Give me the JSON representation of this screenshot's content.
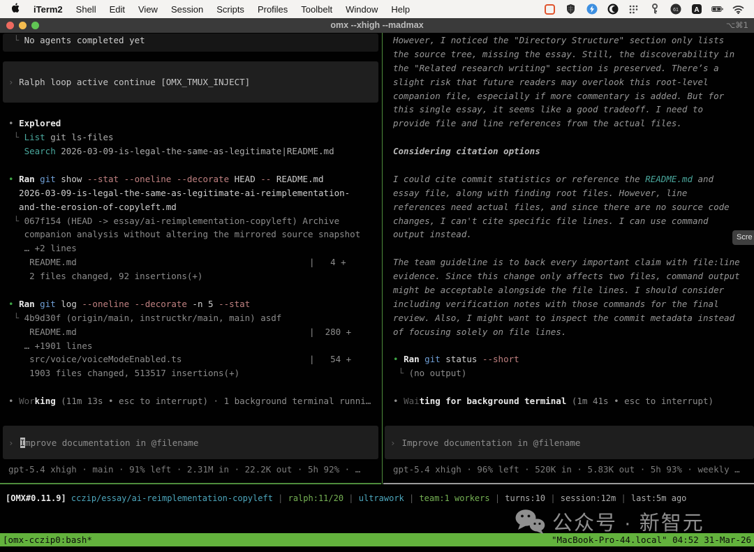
{
  "menubar": {
    "items": [
      "iTerm2",
      "Shell",
      "Edit",
      "View",
      "Session",
      "Scripts",
      "Profiles",
      "Toolbelt",
      "Window",
      "Help"
    ],
    "status_icons": [
      "recording-icon",
      "shield-icon",
      "lightning-circle-icon",
      "crescent-circle-icon",
      "dots-grid-icon",
      "key-icon",
      "timer-61-icon",
      "letter-a-icon",
      "battery-icon",
      "wifi-icon"
    ]
  },
  "titlebar": {
    "title": "omx --xhigh --madmax",
    "shortcut": "⌥⌘1"
  },
  "left_pane": {
    "rows": [
      {
        "s": [
          [
            "dim",
            " └ "
          ],
          [
            "w",
            "No agents completed yet"
          ]
        ]
      },
      {
        "s": []
      },
      {
        "s": []
      },
      {
        "s": [
          [
            "dim",
            "› "
          ],
          [
            "w2",
            "Ralph loop active continue [OMX_TMUX_INJECT]"
          ]
        ]
      },
      {
        "s": []
      },
      {
        "s": []
      },
      {
        "s": [
          [
            "g",
            "• "
          ],
          [
            "bw",
            "Explored"
          ]
        ]
      },
      {
        "s": [
          [
            "dim",
            " └ "
          ],
          [
            "teal",
            "List"
          ],
          [
            "g2",
            " git ls-files"
          ]
        ]
      },
      {
        "s": [
          [
            "g",
            "   "
          ],
          [
            "teal",
            "Search"
          ],
          [
            "g2",
            " 2026-03-09-is-legal-the-same-as-legitimate|README.md"
          ]
        ]
      },
      {
        "s": []
      },
      {
        "s": [
          [
            "green",
            "• "
          ],
          [
            "bw",
            "Ran"
          ],
          [
            "blue",
            " git"
          ],
          [
            "w",
            " show"
          ],
          [
            "rose",
            " --stat --oneline --decorate"
          ],
          [
            "w",
            " HEAD"
          ],
          [
            "rose",
            " --"
          ],
          [
            "w",
            " README.md"
          ]
        ]
      },
      {
        "s": [
          [
            "w",
            "  2026-03-09-is-legal-the-same-as-legitimate-ai-reimplementation-"
          ]
        ]
      },
      {
        "s": [
          [
            "w",
            "  and-the-erosion-of-copyleft.md"
          ]
        ]
      },
      {
        "s": [
          [
            "dim",
            " └ "
          ],
          [
            "g",
            "067f154 (HEAD -> essay/ai-reimplementation-copyleft) Archive"
          ]
        ]
      },
      {
        "s": [
          [
            "g",
            "   companion analysis without altering the mirrored source snapshot"
          ]
        ]
      },
      {
        "s": [
          [
            "g",
            "   … +2 lines"
          ]
        ]
      },
      {
        "s": [
          [
            "g",
            "    README.md"
          ]
        ],
        "r": [
          [
            "g",
            "|   4 +"
          ]
        ]
      },
      {
        "s": [
          [
            "g",
            "    2 files changed, 92 insertions(+)"
          ]
        ]
      },
      {
        "s": []
      },
      {
        "s": [
          [
            "green",
            "• "
          ],
          [
            "bw",
            "Ran"
          ],
          [
            "blue",
            " git"
          ],
          [
            "w",
            " log"
          ],
          [
            "rose",
            " --oneline --decorate"
          ],
          [
            "w",
            " -n 5"
          ],
          [
            "rose",
            " --stat"
          ]
        ]
      },
      {
        "s": [
          [
            "dim",
            " └ "
          ],
          [
            "g",
            "4b9d30f (origin/main, instructkr/main, main) asdf"
          ]
        ]
      },
      {
        "s": [
          [
            "g",
            "    README.md"
          ]
        ],
        "r": [
          [
            "g",
            "|  280 +"
          ]
        ]
      },
      {
        "s": [
          [
            "g",
            "   … +1901 lines"
          ]
        ]
      },
      {
        "s": [
          [
            "g",
            "    src/voice/voiceModeEnabled.ts"
          ]
        ],
        "r": [
          [
            "g",
            "|   54 +"
          ]
        ]
      },
      {
        "s": [
          [
            "g",
            "    1903 files changed, 513517 insertions(+)"
          ]
        ]
      },
      {
        "s": []
      },
      {
        "s": [
          [
            "g",
            "• "
          ],
          [
            "dim",
            "Wor"
          ],
          [
            "bw",
            "king"
          ],
          [
            "g",
            " (11m 13s • esc to interrupt) · 1 background terminal runni…"
          ]
        ]
      }
    ],
    "input": {
      "prompt": "›",
      "cursor": "I",
      "rest": "mprove documentation in @filename"
    },
    "status_line": "gpt-5.4 xhigh · main · 91% left · 2.31M in · 22.2K out · 5h 92% · …"
  },
  "right_pane": {
    "rows": [
      {
        "s": [
          [
            "it",
            "However, I noticed the \"Directory Structure\" section only lists"
          ]
        ]
      },
      {
        "s": [
          [
            "it",
            "the source tree, missing the essay. Still, the discoverability in"
          ]
        ]
      },
      {
        "s": [
          [
            "it",
            "the \"Related research writing\" section is preserved. There’s a"
          ]
        ]
      },
      {
        "s": [
          [
            "it",
            "slight risk that future readers may overlook this root-level"
          ]
        ]
      },
      {
        "s": [
          [
            "it",
            "companion file, especially if more commentary is added. But for"
          ]
        ]
      },
      {
        "s": [
          [
            "it",
            "this single essay, it seems like a good tradeoff. I need to"
          ]
        ]
      },
      {
        "s": [
          [
            "it",
            "provide file and line references from the actual files."
          ]
        ]
      },
      {
        "s": []
      },
      {
        "s": [
          [
            "bit",
            "Considering citation options"
          ]
        ]
      },
      {
        "s": []
      },
      {
        "s": [
          [
            "it",
            "I could cite commit statistics or reference the "
          ],
          [
            "tealit",
            "README.md"
          ],
          [
            "it",
            " and"
          ]
        ]
      },
      {
        "s": [
          [
            "it",
            "essay file, along with finding root files. However, line"
          ]
        ]
      },
      {
        "s": [
          [
            "it",
            "references need actual files, and since there are no source code"
          ]
        ]
      },
      {
        "s": [
          [
            "it",
            "changes, I can't cite specific file lines. I can use command"
          ]
        ]
      },
      {
        "s": [
          [
            "it",
            "output instead."
          ]
        ]
      },
      {
        "s": []
      },
      {
        "s": [
          [
            "it",
            "The team guideline is to back every important claim with file:line"
          ]
        ]
      },
      {
        "s": [
          [
            "it",
            "evidence. Since this change only affects two files, command output"
          ]
        ]
      },
      {
        "s": [
          [
            "it",
            "might be acceptable alongside the file lines. I should consider"
          ]
        ]
      },
      {
        "s": [
          [
            "it",
            "including verification notes with those commands for the final"
          ]
        ]
      },
      {
        "s": [
          [
            "it",
            "review. Also, I might want to inspect the commit metadata instead"
          ]
        ]
      },
      {
        "s": [
          [
            "it",
            "of focusing solely on file lines."
          ]
        ]
      },
      {
        "s": []
      },
      {
        "s": [
          [
            "green",
            "• "
          ],
          [
            "bw",
            "Ran"
          ],
          [
            "blue",
            " git"
          ],
          [
            "w",
            " status"
          ],
          [
            "rose",
            " --short"
          ]
        ]
      },
      {
        "s": [
          [
            "dim",
            " └ "
          ],
          [
            "g",
            "(no output)"
          ]
        ]
      },
      {
        "s": []
      },
      {
        "s": [
          [
            "g",
            "• "
          ],
          [
            "dim",
            "Wai"
          ],
          [
            "bw",
            "ting for background terminal"
          ],
          [
            "g",
            " (1m 41s • esc to interrupt)"
          ]
        ]
      }
    ],
    "input": {
      "prompt": "›",
      "text": "Improve documentation in @filename"
    },
    "status_line": "gpt-5.4 xhigh · 96% left · 520K in · 5.83K out · 5h 93% · weekly …"
  },
  "screen_button": {
    "label": "Scre"
  },
  "omx_status": {
    "segments": [
      [
        "bw",
        "[OMX#0.11.9]"
      ],
      [
        "cyan",
        " cczip/essay/ai-reimplementation-copyleft "
      ],
      [
        "dim",
        "| "
      ],
      [
        "lime",
        "ralph:11/20 "
      ],
      [
        "dim",
        "| "
      ],
      [
        "cyan",
        "ultrawork "
      ],
      [
        "dim",
        "| "
      ],
      [
        "lime",
        "team:1 workers "
      ],
      [
        "dim",
        "| "
      ],
      [
        "g2",
        "turns:10 "
      ],
      [
        "dim",
        "| "
      ],
      [
        "g2",
        "session:12m "
      ],
      [
        "dim",
        "| "
      ],
      [
        "g2",
        "last:5m ago"
      ]
    ]
  },
  "tmux_bar": {
    "left": "[omx-cczip0:bash*",
    "right": "\"MacBook-Pro-44.local\" 04:52 31-Mar-26"
  },
  "watermark": {
    "text": "公众号 · 新智元"
  },
  "colors": {
    "tmux_bar_green": "#63b23d",
    "active_pane_border": "#4e8c3c",
    "inactive_pane_border": "#9b9b9b",
    "bullet_green": "#3fa546",
    "teal": "#4aa89d",
    "cyan": "#4da7bd",
    "git_blue": "#6f9fd6",
    "flag_rose": "#c08181",
    "box_bg": "#1e1e1e"
  }
}
